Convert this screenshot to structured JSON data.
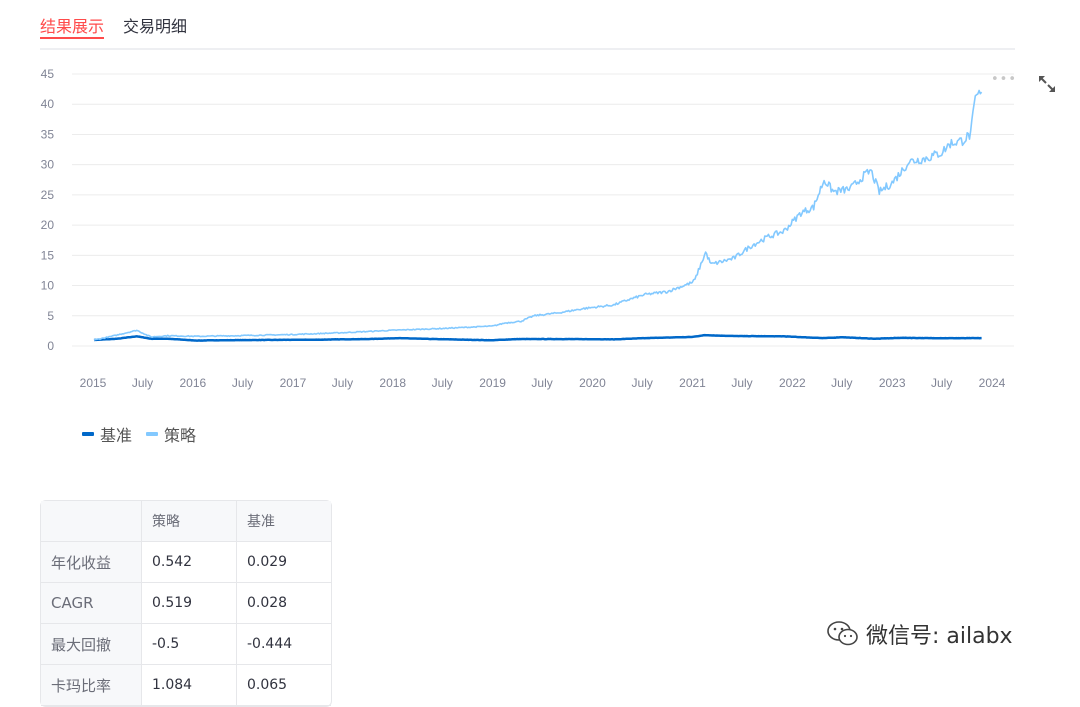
{
  "tabs": [
    {
      "label": "结果展示",
      "active": true
    },
    {
      "label": "交易明细",
      "active": false
    }
  ],
  "colors": {
    "accent": "#ff4b4b",
    "benchmark": "#0068c9",
    "strategy": "#83c9ff",
    "grid": "#ececec",
    "axis_text": "#808495"
  },
  "chart_data": {
    "type": "line",
    "title": "",
    "xlabel": "",
    "ylabel": "",
    "x_range": [
      "2015-01-05",
      "2023-11-24"
    ],
    "ylim": [
      0,
      45
    ],
    "y_ticks": [
      0,
      5,
      10,
      15,
      20,
      25,
      30,
      35,
      40,
      45
    ],
    "x_ticks": [
      "2015",
      "July",
      "2016",
      "July",
      "2017",
      "July",
      "2018",
      "July",
      "2019",
      "July",
      "2020",
      "July",
      "2021",
      "July",
      "2022",
      "July",
      "2023",
      "July",
      "2024"
    ],
    "grid": true,
    "legend_position": "bottom-left",
    "series": [
      {
        "name": "基准",
        "color": "#0068c9",
        "points": [
          [
            "2015-01-05",
            1.0
          ],
          [
            "2015-04-01",
            1.2
          ],
          [
            "2015-06-10",
            1.6
          ],
          [
            "2015-08-01",
            1.2
          ],
          [
            "2015-10-01",
            1.2
          ],
          [
            "2016-01-15",
            0.9
          ],
          [
            "2016-04-01",
            0.95
          ],
          [
            "2016-10-01",
            1.0
          ],
          [
            "2017-04-01",
            1.05
          ],
          [
            "2017-10-01",
            1.15
          ],
          [
            "2018-01-20",
            1.3
          ],
          [
            "2018-06-01",
            1.15
          ],
          [
            "2018-12-31",
            0.95
          ],
          [
            "2019-04-01",
            1.15
          ],
          [
            "2019-10-01",
            1.15
          ],
          [
            "2020-03-20",
            1.1
          ],
          [
            "2020-07-10",
            1.3
          ],
          [
            "2021-01-01",
            1.5
          ],
          [
            "2021-02-15",
            1.8
          ],
          [
            "2021-06-01",
            1.65
          ],
          [
            "2021-12-01",
            1.6
          ],
          [
            "2022-04-25",
            1.3
          ],
          [
            "2022-07-01",
            1.45
          ],
          [
            "2022-10-31",
            1.2
          ],
          [
            "2023-02-01",
            1.35
          ],
          [
            "2023-06-01",
            1.3
          ],
          [
            "2023-11-24",
            1.3
          ]
        ]
      },
      {
        "name": "策略",
        "color": "#83c9ff",
        "points": [
          [
            "2015-01-05",
            1.0
          ],
          [
            "2015-03-01",
            1.5
          ],
          [
            "2015-06-10",
            2.6
          ],
          [
            "2015-08-01",
            1.5
          ],
          [
            "2015-10-01",
            1.7
          ],
          [
            "2016-01-20",
            1.6
          ],
          [
            "2016-06-01",
            1.7
          ],
          [
            "2017-01-01",
            1.9
          ],
          [
            "2017-07-01",
            2.2
          ],
          [
            "2018-01-01",
            2.6
          ],
          [
            "2018-07-01",
            2.9
          ],
          [
            "2019-01-02",
            3.3
          ],
          [
            "2019-02-15",
            3.8
          ],
          [
            "2019-04-15",
            4.1
          ],
          [
            "2019-06-01",
            5.0
          ],
          [
            "2019-09-01",
            5.5
          ],
          [
            "2019-12-01",
            6.2
          ],
          [
            "2020-03-20",
            6.8
          ],
          [
            "2020-05-01",
            7.5
          ],
          [
            "2020-07-10",
            8.5
          ],
          [
            "2020-10-01",
            9.0
          ],
          [
            "2020-12-31",
            10.5
          ],
          [
            "2021-01-10",
            11.0
          ],
          [
            "2021-02-18",
            15.5
          ],
          [
            "2021-03-10",
            13.5
          ],
          [
            "2021-06-01",
            14.5
          ],
          [
            "2021-08-01",
            16.5
          ],
          [
            "2021-10-01",
            18.0
          ],
          [
            "2021-12-01",
            19.0
          ],
          [
            "2022-02-01",
            22.0
          ],
          [
            "2022-03-20",
            23.0
          ],
          [
            "2022-04-27",
            27.5
          ],
          [
            "2022-06-01",
            25.5
          ],
          [
            "2022-08-01",
            26.0
          ],
          [
            "2022-09-15",
            28.0
          ],
          [
            "2022-10-15",
            29.0
          ],
          [
            "2022-11-15",
            25.5
          ],
          [
            "2023-01-01",
            27.0
          ],
          [
            "2023-02-15",
            29.5
          ],
          [
            "2023-03-01",
            30.5
          ],
          [
            "2023-05-01",
            31.0
          ],
          [
            "2023-07-01",
            32.0
          ],
          [
            "2023-08-01",
            33.5
          ],
          [
            "2023-09-15",
            34.0
          ],
          [
            "2023-10-15",
            35.0
          ],
          [
            "2023-11-01",
            41.0
          ],
          [
            "2023-11-24",
            42.0
          ]
        ]
      }
    ]
  },
  "legend": [
    {
      "label": "基准",
      "color": "#0068c9"
    },
    {
      "label": "策略",
      "color": "#83c9ff"
    }
  ],
  "table": {
    "headers": [
      "",
      "策略",
      "基准"
    ],
    "rows": [
      [
        "年化收益",
        "0.542",
        "0.029"
      ],
      [
        "CAGR",
        "0.519",
        "0.028"
      ],
      [
        "最大回撤",
        "-0.5",
        "-0.444"
      ],
      [
        "卡玛比率",
        "1.084",
        "0.065"
      ]
    ]
  },
  "watermark": {
    "text": "微信号: ailabx"
  },
  "icons": {
    "expand": "expand-icon",
    "menu": "more-dots-icon",
    "watermark": "wechat-icon"
  }
}
